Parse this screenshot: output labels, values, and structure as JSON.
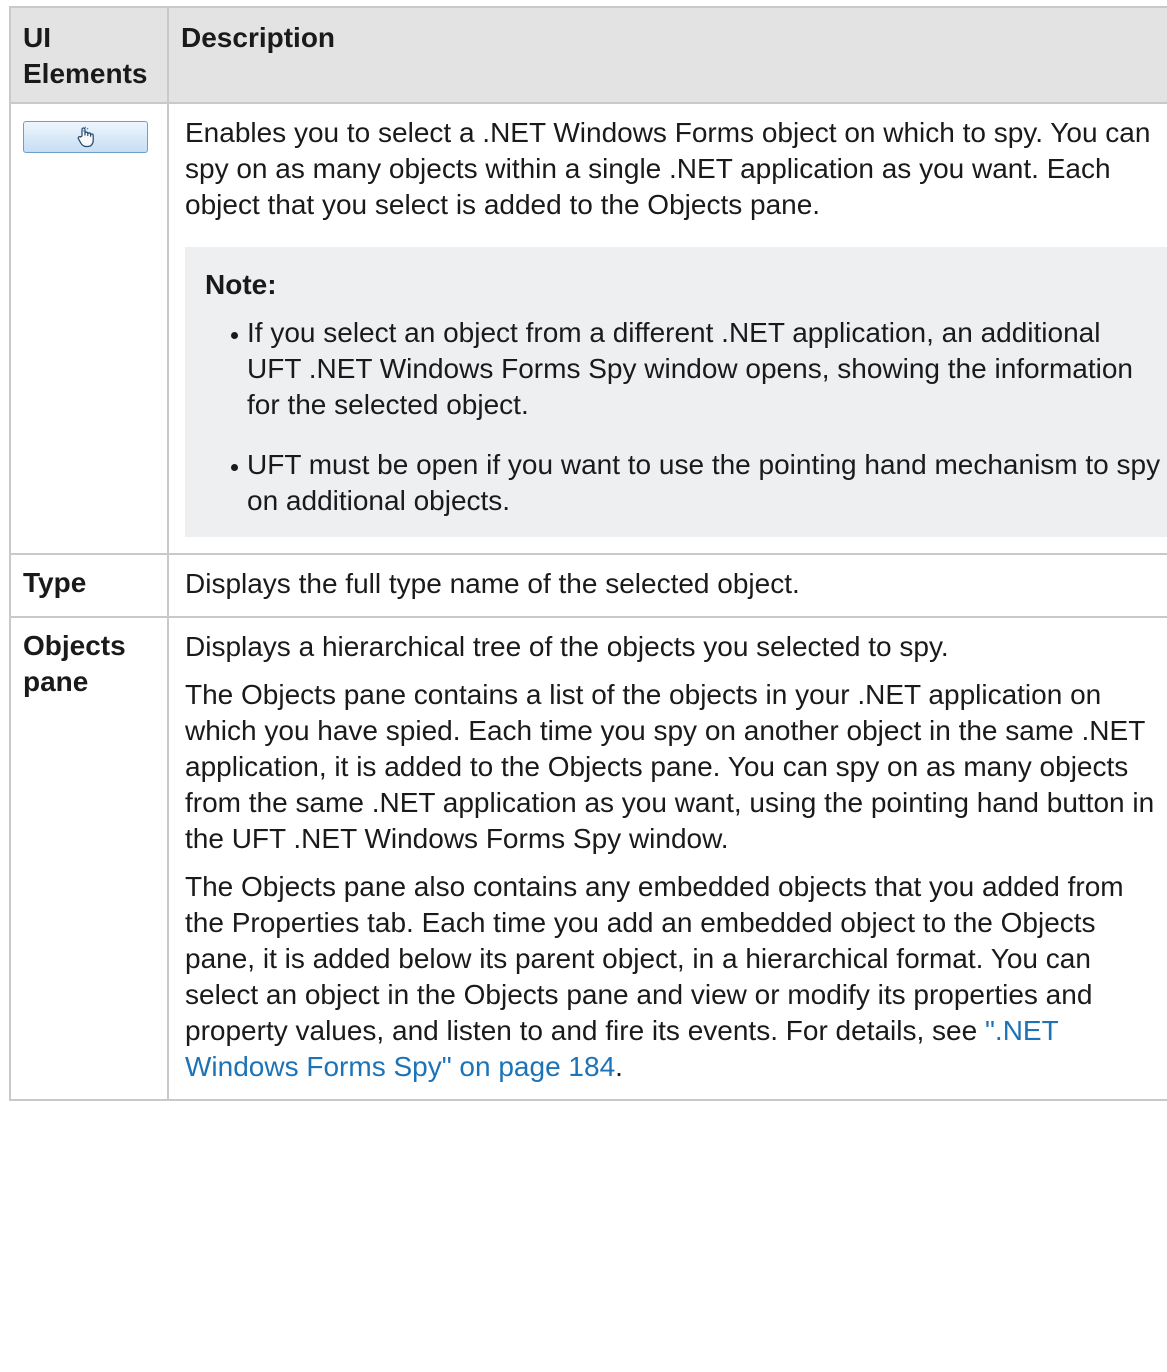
{
  "table": {
    "headers": {
      "ui_elements": "UI Elements",
      "description": "Description"
    },
    "rows": {
      "hand_button": {
        "icon": "pointing-hand-icon",
        "description": "Enables you to select a .NET Windows Forms object on which to spy. You can spy on as many objects within a single .NET application as you want. Each object that you select is added to the Objects pane.",
        "note": {
          "title": "Note:",
          "items": [
            "If you select an object from a different .NET application, an additional UFT .NET Windows Forms Spy window opens, showing the information for the selected object.",
            "UFT must be open if you want to use the pointing hand mechanism to spy on additional objects."
          ]
        }
      },
      "type": {
        "label": "Type",
        "description": "Displays the full type name of the selected object."
      },
      "objects_pane": {
        "label": "Objects pane",
        "paragraphs": [
          "Displays a hierarchical tree of the objects you selected to spy.",
          "The Objects pane contains a list of the objects in your .NET application on which you have spied. Each time you spy on another object in the same .NET application, it is added to the Objects pane. You can spy on as many objects from the same .NET application as you want, using the pointing hand button in the UFT .NET Windows Forms Spy window."
        ],
        "last_paragraph": {
          "text": "The Objects pane also contains any embedded objects that you added from the Properties tab. Each time you add an embedded object to the Objects pane, it is added below its parent object, in a hierarchical format. You can select an object in the Objects pane and view or modify its properties and property values, and listen to and fire its events. For details, see ",
          "link_text": "\".NET Windows Forms Spy\" on page 184",
          "end": "."
        }
      }
    }
  },
  "colors": {
    "header_bg": "#e3e3e3",
    "border": "#c9c9c9",
    "note_bg": "#edeff0",
    "link": "#1c73b8"
  }
}
